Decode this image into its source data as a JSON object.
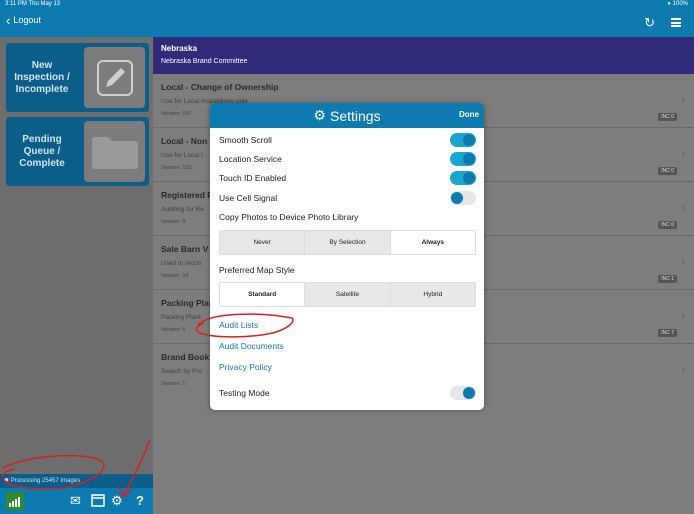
{
  "status_bar": {
    "time_date": "3:11 PM  Thu May 13",
    "battery": "100%"
  },
  "left_header": {
    "logout_label": "Logout"
  },
  "sidebar": {
    "tiles": [
      {
        "label": "New Inspection / Incomplete",
        "icon": "pencil-icon"
      },
      {
        "label": "Pending Queue / Complete",
        "icon": "folder-icon"
      }
    ],
    "processing_text": "Processing 25457 Images",
    "bottom_icons": [
      "signal-icon",
      "mail-icon",
      "calendar-icon",
      "gears-icon",
      "help-icon"
    ]
  },
  "region": {
    "state": "Nebraska",
    "org": "Nebraska Brand Committee"
  },
  "list": [
    {
      "title": "Local - Change of Ownership",
      "desc": "Use for Local Inspections only",
      "version": "Version: 147",
      "badge": "INC 0"
    },
    {
      "title": "Local - Non",
      "desc": "Use for Local I",
      "version": "Version: 122",
      "badge": "INC 0"
    },
    {
      "title": "Registered F",
      "desc": "Auditing for Re",
      "version": "Version: 9",
      "badge": "INC 0"
    },
    {
      "title": "Sale Barn V",
      "desc": "Used to recon",
      "version": "Version: 14",
      "badge": "INC 1"
    },
    {
      "title": "Packing Plan",
      "desc": "Packing Plant",
      "version": "Version: 5",
      "badge": "INC 7"
    },
    {
      "title": "Brand Book",
      "desc": "Search by Pro",
      "version": "Version: 1",
      "badge": ""
    }
  ],
  "settings": {
    "title": "Settings",
    "done": "Done",
    "toggles": [
      {
        "label": "Smooth Scroll",
        "on": true
      },
      {
        "label": "Location Service",
        "on": true
      },
      {
        "label": "Touch ID Enabled",
        "on": true
      },
      {
        "label": "Use Cell Signal",
        "on": false
      }
    ],
    "copy_photos_label": "Copy Photos to Device Photo Library",
    "copy_options": [
      "Never",
      "By Selection",
      "Always"
    ],
    "copy_selected": "Always",
    "map_label": "Preferred Map Style",
    "map_options": [
      "Standard",
      "Satellite",
      "Hybrid"
    ],
    "map_selected": "Standard",
    "links": [
      "Audit Lists",
      "Audit Documents",
      "Privacy Policy"
    ],
    "testing_mode": {
      "label": "Testing Mode",
      "on": false
    }
  },
  "colors": {
    "brand_blue": "#0e7bb0",
    "region_purple": "#2f2a7a",
    "toggle_on": "#1aa6cf",
    "annotation_red": "#d62020"
  }
}
